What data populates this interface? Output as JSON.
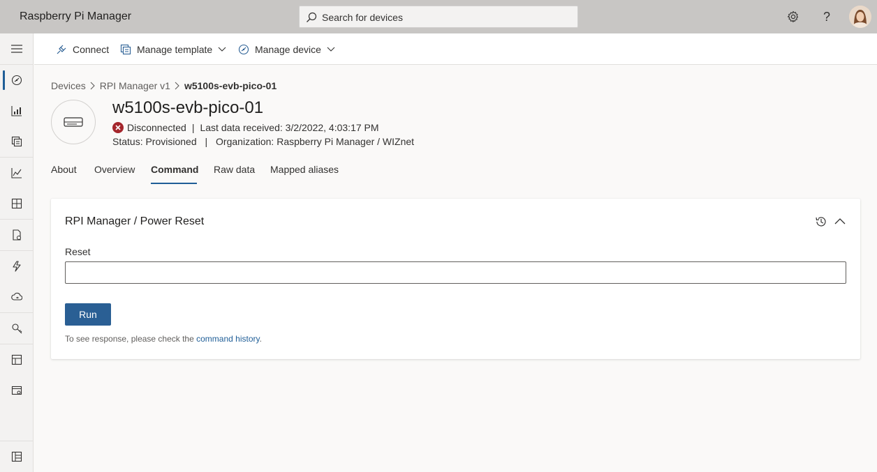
{
  "header": {
    "app_title": "Raspberry Pi Manager",
    "search_placeholder": "Search for devices",
    "help_glyph": "?"
  },
  "nav": {
    "items": [
      "dashboard-icon",
      "devices-icon",
      "device-templates-icon",
      "analytics-icon",
      "dashboards-icon",
      "jobs-icon",
      "rules-icon",
      "data-export-icon",
      "permissions-icon",
      "customization-icon",
      "settings-icon",
      "apps-icon"
    ]
  },
  "command_bar": {
    "connect_label": "Connect",
    "manage_template_label": "Manage template",
    "manage_device_label": "Manage device"
  },
  "breadcrumb": {
    "items": [
      "Devices",
      "RPI Manager v1"
    ],
    "current": "w5100s-evb-pico-01"
  },
  "device": {
    "name": "w5100s-evb-pico-01",
    "connection_status": "Disconnected",
    "last_data": "Last data received: 3/2/2022, 4:03:17 PM",
    "status": "Status: Provisioned",
    "organization": "Organization: Raspberry Pi Manager / WIZnet",
    "status_color": "#a4262c"
  },
  "tabs": [
    "About",
    "Overview",
    "Command",
    "Raw data",
    "Mapped aliases"
  ],
  "active_tab": "Command",
  "command_card": {
    "title": "RPI Manager / Power Reset",
    "field_label": "Reset",
    "field_value": "",
    "run_label": "Run",
    "hint_prefix": "To see response, please check the ",
    "hint_link": "command history",
    "hint_suffix": "."
  },
  "colors": {
    "accent": "#1f5e97",
    "header_bg": "#c8c6c4",
    "run_button": "#2a5f94"
  }
}
